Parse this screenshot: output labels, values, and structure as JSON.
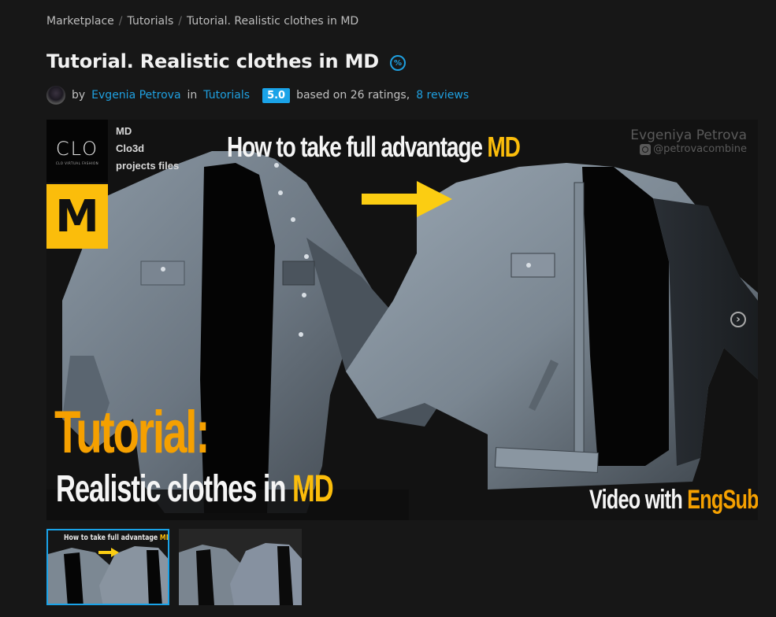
{
  "breadcrumb": [
    {
      "label": "Marketplace"
    },
    {
      "label": "Tutorials"
    },
    {
      "label": "Tutorial. Realistic clothes in MD"
    }
  ],
  "breadcrumb_separator": "/",
  "product": {
    "title": "Tutorial. Realistic clothes in MD",
    "discount_icon": "percent-badge-icon",
    "by_label": "by",
    "author": "Evgenia Petrova",
    "in_label": "in",
    "category": "Tutorials",
    "rating": "5.0",
    "ratings_text": "based on 26 ratings,",
    "reviews_link": "8 reviews"
  },
  "gallery": {
    "main_image": {
      "clo_logo": "CLO",
      "clo_tagline": "CLO VIRTUAL FASHION",
      "md_logo": "M",
      "files_lines": [
        "MD",
        "Clo3d",
        "projects files"
      ],
      "headline_prefix": "How to take full advantage ",
      "headline_accent": "MD",
      "watermark_name": "Evgeniya Petrova",
      "watermark_handle": "@petrovacombine",
      "tutorial_label": "Tutorial:",
      "subtitle_prefix": "Realistic clothes in ",
      "subtitle_accent": "MD",
      "video_prefix": "Video with ",
      "video_accent": "EngSub"
    },
    "next_icon": "chevron-right-circle-icon",
    "thumbnails": [
      {
        "caption_prefix": "How to take full advantage ",
        "caption_accent": "MD",
        "active": true
      },
      {
        "caption_prefix": "",
        "caption_accent": "",
        "active": false
      }
    ]
  },
  "colors": {
    "background": "#171717",
    "link": "#1fa0e0",
    "rating_badge": "#1aa3e8",
    "accent_yellow": "#fbbd0b",
    "accent_orange": "#f5a000"
  }
}
